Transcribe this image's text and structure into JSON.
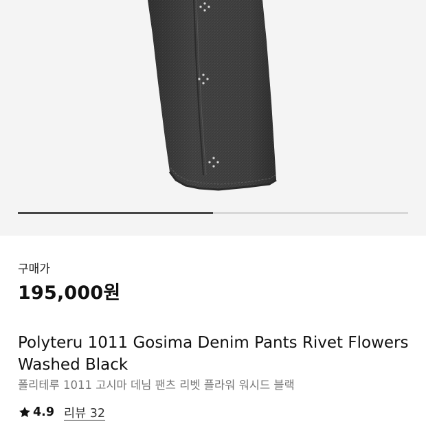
{
  "gallery": {
    "image_alt": "Polyteru 1011 Gosima Denim Pants Rivet Flowers Washed Black",
    "progress_fraction": 0.5
  },
  "product": {
    "price_label": "구매가",
    "price": "195,000원",
    "title_en": "Polyteru 1011 Gosima Denim Pants Rivet Flowers Washed Black",
    "title_ko": "폴리테루 1011 고시마 데님 팬츠 리벳 플라워 워시드 블랙",
    "rating": "4.9",
    "review_link": "리뷰 32"
  },
  "icons": {
    "star": "star-icon"
  },
  "colors": {
    "background_gallery": "#f4f4f4",
    "denim": "#3f3f3f",
    "text_secondary": "#777777"
  }
}
